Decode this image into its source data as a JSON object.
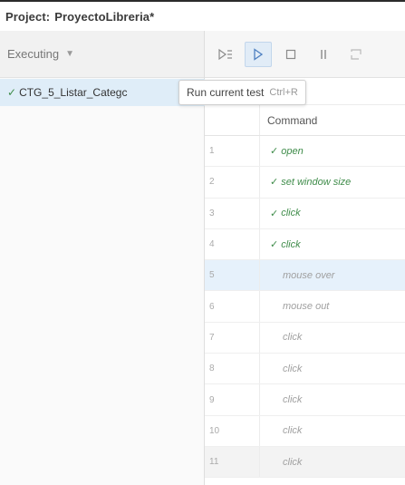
{
  "project": {
    "label": "Project:",
    "name": "ProyectoLibreria*"
  },
  "suite_panel": {
    "dropdown_label": "Executing",
    "test": {
      "status": "✓",
      "name": "CTG_5_Listar_Categc"
    }
  },
  "toolbar": {
    "run_all_icon": "run-all-icon",
    "run_current_icon": "run-current-icon",
    "stop_icon": "stop-icon",
    "pause_icon": "pause-icon",
    "step_icon": "step-icon"
  },
  "tooltip": {
    "text": "Run current test",
    "shortcut": "Ctrl+R"
  },
  "table": {
    "header": "Command",
    "rows": [
      {
        "num": "1",
        "command": "open",
        "status": "done"
      },
      {
        "num": "2",
        "command": "set window size",
        "status": "done"
      },
      {
        "num": "3",
        "command": "click",
        "status": "done"
      },
      {
        "num": "4",
        "command": "click",
        "status": "done"
      },
      {
        "num": "5",
        "command": "mouse over",
        "status": "current"
      },
      {
        "num": "6",
        "command": "mouse out",
        "status": "pending"
      },
      {
        "num": "7",
        "command": "click",
        "status": "pending"
      },
      {
        "num": "8",
        "command": "click",
        "status": "pending"
      },
      {
        "num": "9",
        "command": "click",
        "status": "pending"
      },
      {
        "num": "10",
        "command": "click",
        "status": "pending"
      },
      {
        "num": "11",
        "command": "click",
        "status": "pending"
      }
    ]
  },
  "colors": {
    "success": "#3f8c4a",
    "selection": "#dfedf8",
    "accent": "#4d7fc0"
  }
}
